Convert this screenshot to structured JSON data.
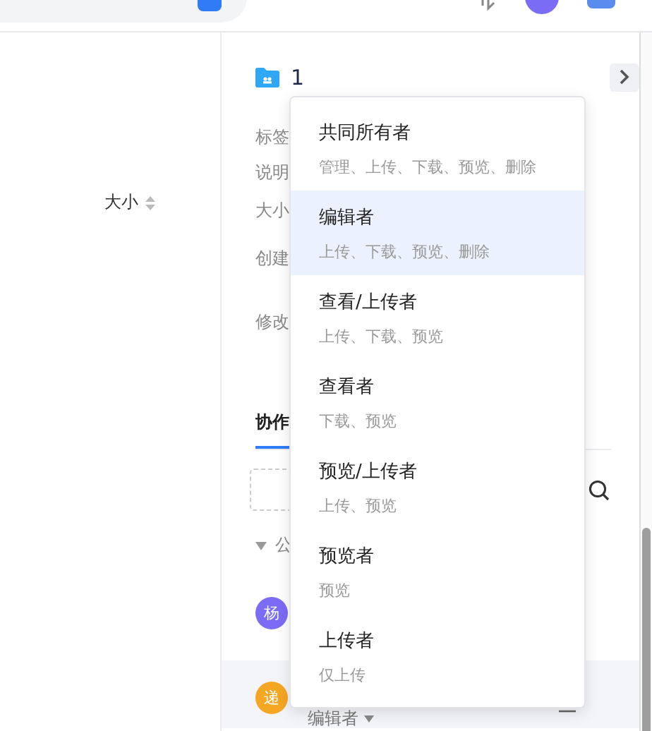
{
  "file_list": {
    "column_header": "大小"
  },
  "details": {
    "name": "1",
    "fields": [
      "标签",
      "说明",
      "大小",
      "创建",
      "修改"
    ]
  },
  "tabs": [
    {
      "label": "协作",
      "selected": true
    }
  ],
  "group": {
    "label": "公",
    "expanded": true
  },
  "members": [
    {
      "avatar": "杨",
      "color": "#7b6cf6",
      "selected": false
    },
    {
      "avatar": "递",
      "color": "#f5a623",
      "role": "编辑者",
      "selected": true
    }
  ],
  "role_menu": {
    "items": [
      {
        "title": "共同所有者",
        "description": "管理、上传、下载、预览、删除",
        "selected": false
      },
      {
        "title": "编辑者",
        "description": "上传、下载、预览、删除",
        "selected": true
      },
      {
        "title": "查看/上传者",
        "description": "上传、下载、预览",
        "selected": false
      },
      {
        "title": "查看者",
        "description": "下载、预览",
        "selected": false
      },
      {
        "title": "预览/上传者",
        "description": "上传、预览",
        "selected": false
      },
      {
        "title": "预览者",
        "description": "预览",
        "selected": false
      },
      {
        "title": "上传者",
        "description": "仅上传",
        "selected": false
      }
    ]
  }
}
